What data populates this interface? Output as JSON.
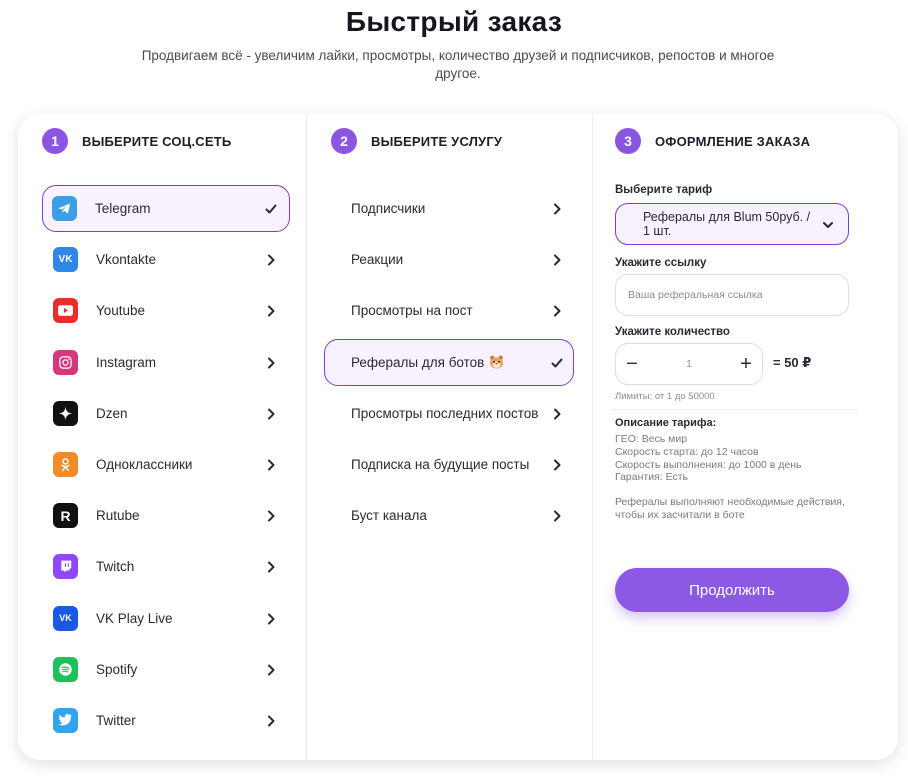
{
  "header": {
    "title": "Быстрый заказ",
    "subtitle": "Продвигаем всё -  увеличим лайки, просмотры, количество друзей и подписчиков, репостов и многое другое."
  },
  "steps": [
    {
      "number": "1",
      "title": "ВЫБЕРИТЕ СОЦ.СЕТЬ"
    },
    {
      "number": "2",
      "title": "ВЫБЕРИТЕ УСЛУГУ"
    },
    {
      "number": "3",
      "title": "ОФОРМЛЕНИЕ ЗАКАЗА"
    }
  ],
  "networks": [
    {
      "label": "Telegram",
      "icon": "telegram-icon",
      "color": "#3aa0e3",
      "selected": true
    },
    {
      "label": "Vkontakte",
      "icon": "vk-icon",
      "color": "#2f86e8",
      "selected": false
    },
    {
      "label": "Youtube",
      "icon": "youtube-icon",
      "color": "#ee2b2b",
      "selected": false
    },
    {
      "label": "Instagram",
      "icon": "instagram-icon",
      "color": "#d7367e",
      "selected": false
    },
    {
      "label": "Dzen",
      "icon": "dzen-icon",
      "color": "#111111",
      "selected": false
    },
    {
      "label": "Одноклассники",
      "icon": "ok-icon",
      "color": "#f28b2a",
      "selected": false
    },
    {
      "label": "Rutube",
      "icon": "rutube-icon",
      "color": "#111111",
      "selected": false
    },
    {
      "label": "Twitch",
      "icon": "twitch-icon",
      "color": "#9146ff",
      "selected": false
    },
    {
      "label": "VK Play Live",
      "icon": "vk-play-live-icon",
      "color": "#1b58e8",
      "selected": false
    },
    {
      "label": "Spotify",
      "icon": "spotify-icon",
      "color": "#1fbf5a",
      "selected": false
    },
    {
      "label": "Twitter",
      "icon": "twitter-icon",
      "color": "#2ea5ee",
      "selected": false
    }
  ],
  "services": [
    {
      "label": "Подписчики",
      "selected": false
    },
    {
      "label": "Реакции",
      "selected": false
    },
    {
      "label": "Просмотры на пост",
      "selected": false
    },
    {
      "label": "Рефералы для ботов",
      "selected": true,
      "emoji": "hamster-icon"
    },
    {
      "label": "Просмотры последних постов",
      "selected": false
    },
    {
      "label": "Подписка на будущие посты",
      "selected": false
    },
    {
      "label": "Буст канала",
      "selected": false
    }
  ],
  "order": {
    "tariff_label": "Выберите тариф",
    "tariff_value": "Рефералы для Blum 50руб. / 1 шт.",
    "link_label": "Укажите ссылку",
    "link_placeholder": "Ваша реферальная ссылка",
    "link_value": "",
    "qty_label": "Укажите количество",
    "qty_minus": "−",
    "qty_value": "1",
    "qty_plus": "+",
    "qty_total": "= 50 ₽",
    "limits": "Лимиты: от 1 до 50000",
    "desc_title": "Описание тарифа:",
    "desc_lines": [
      "ГЕО: Весь мир",
      "Скорость старта: до 12 часов",
      "Скорость выполнения: до 1000 в день",
      "Гарантия: Есть"
    ],
    "desc_note": "Рефералы выполняют необходимые действия, чтобы их засчитали в боте",
    "continue_label": "Продолжить"
  },
  "colors": {
    "accent": "#8a55e0",
    "selected_border": "#7b3fd6",
    "selected_bg": "#f7f2fe"
  }
}
